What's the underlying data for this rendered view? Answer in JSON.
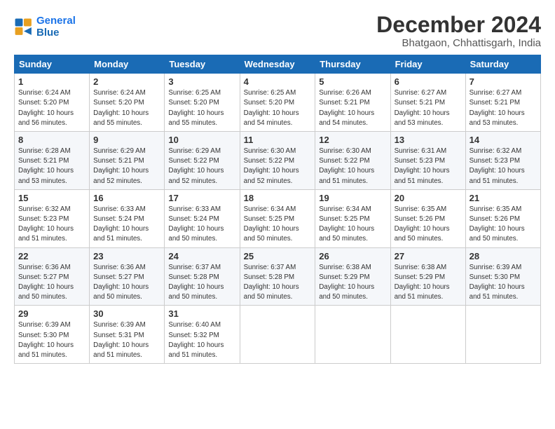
{
  "logo": {
    "line1": "General",
    "line2": "Blue"
  },
  "title": "December 2024",
  "subtitle": "Bhatgaon, Chhattisgarh, India",
  "days_of_week": [
    "Sunday",
    "Monday",
    "Tuesday",
    "Wednesday",
    "Thursday",
    "Friday",
    "Saturday"
  ],
  "weeks": [
    [
      {
        "day": 1,
        "info": "Sunrise: 6:24 AM\nSunset: 5:20 PM\nDaylight: 10 hours\nand 56 minutes."
      },
      {
        "day": 2,
        "info": "Sunrise: 6:24 AM\nSunset: 5:20 PM\nDaylight: 10 hours\nand 55 minutes."
      },
      {
        "day": 3,
        "info": "Sunrise: 6:25 AM\nSunset: 5:20 PM\nDaylight: 10 hours\nand 55 minutes."
      },
      {
        "day": 4,
        "info": "Sunrise: 6:25 AM\nSunset: 5:20 PM\nDaylight: 10 hours\nand 54 minutes."
      },
      {
        "day": 5,
        "info": "Sunrise: 6:26 AM\nSunset: 5:21 PM\nDaylight: 10 hours\nand 54 minutes."
      },
      {
        "day": 6,
        "info": "Sunrise: 6:27 AM\nSunset: 5:21 PM\nDaylight: 10 hours\nand 53 minutes."
      },
      {
        "day": 7,
        "info": "Sunrise: 6:27 AM\nSunset: 5:21 PM\nDaylight: 10 hours\nand 53 minutes."
      }
    ],
    [
      {
        "day": 8,
        "info": "Sunrise: 6:28 AM\nSunset: 5:21 PM\nDaylight: 10 hours\nand 53 minutes."
      },
      {
        "day": 9,
        "info": "Sunrise: 6:29 AM\nSunset: 5:21 PM\nDaylight: 10 hours\nand 52 minutes."
      },
      {
        "day": 10,
        "info": "Sunrise: 6:29 AM\nSunset: 5:22 PM\nDaylight: 10 hours\nand 52 minutes."
      },
      {
        "day": 11,
        "info": "Sunrise: 6:30 AM\nSunset: 5:22 PM\nDaylight: 10 hours\nand 52 minutes."
      },
      {
        "day": 12,
        "info": "Sunrise: 6:30 AM\nSunset: 5:22 PM\nDaylight: 10 hours\nand 51 minutes."
      },
      {
        "day": 13,
        "info": "Sunrise: 6:31 AM\nSunset: 5:23 PM\nDaylight: 10 hours\nand 51 minutes."
      },
      {
        "day": 14,
        "info": "Sunrise: 6:32 AM\nSunset: 5:23 PM\nDaylight: 10 hours\nand 51 minutes."
      }
    ],
    [
      {
        "day": 15,
        "info": "Sunrise: 6:32 AM\nSunset: 5:23 PM\nDaylight: 10 hours\nand 51 minutes."
      },
      {
        "day": 16,
        "info": "Sunrise: 6:33 AM\nSunset: 5:24 PM\nDaylight: 10 hours\nand 51 minutes."
      },
      {
        "day": 17,
        "info": "Sunrise: 6:33 AM\nSunset: 5:24 PM\nDaylight: 10 hours\nand 50 minutes."
      },
      {
        "day": 18,
        "info": "Sunrise: 6:34 AM\nSunset: 5:25 PM\nDaylight: 10 hours\nand 50 minutes."
      },
      {
        "day": 19,
        "info": "Sunrise: 6:34 AM\nSunset: 5:25 PM\nDaylight: 10 hours\nand 50 minutes."
      },
      {
        "day": 20,
        "info": "Sunrise: 6:35 AM\nSunset: 5:26 PM\nDaylight: 10 hours\nand 50 minutes."
      },
      {
        "day": 21,
        "info": "Sunrise: 6:35 AM\nSunset: 5:26 PM\nDaylight: 10 hours\nand 50 minutes."
      }
    ],
    [
      {
        "day": 22,
        "info": "Sunrise: 6:36 AM\nSunset: 5:27 PM\nDaylight: 10 hours\nand 50 minutes."
      },
      {
        "day": 23,
        "info": "Sunrise: 6:36 AM\nSunset: 5:27 PM\nDaylight: 10 hours\nand 50 minutes."
      },
      {
        "day": 24,
        "info": "Sunrise: 6:37 AM\nSunset: 5:28 PM\nDaylight: 10 hours\nand 50 minutes."
      },
      {
        "day": 25,
        "info": "Sunrise: 6:37 AM\nSunset: 5:28 PM\nDaylight: 10 hours\nand 50 minutes."
      },
      {
        "day": 26,
        "info": "Sunrise: 6:38 AM\nSunset: 5:29 PM\nDaylight: 10 hours\nand 50 minutes."
      },
      {
        "day": 27,
        "info": "Sunrise: 6:38 AM\nSunset: 5:29 PM\nDaylight: 10 hours\nand 51 minutes."
      },
      {
        "day": 28,
        "info": "Sunrise: 6:39 AM\nSunset: 5:30 PM\nDaylight: 10 hours\nand 51 minutes."
      }
    ],
    [
      {
        "day": 29,
        "info": "Sunrise: 6:39 AM\nSunset: 5:30 PM\nDaylight: 10 hours\nand 51 minutes."
      },
      {
        "day": 30,
        "info": "Sunrise: 6:39 AM\nSunset: 5:31 PM\nDaylight: 10 hours\nand 51 minutes."
      },
      {
        "day": 31,
        "info": "Sunrise: 6:40 AM\nSunset: 5:32 PM\nDaylight: 10 hours\nand 51 minutes."
      },
      null,
      null,
      null,
      null
    ]
  ]
}
